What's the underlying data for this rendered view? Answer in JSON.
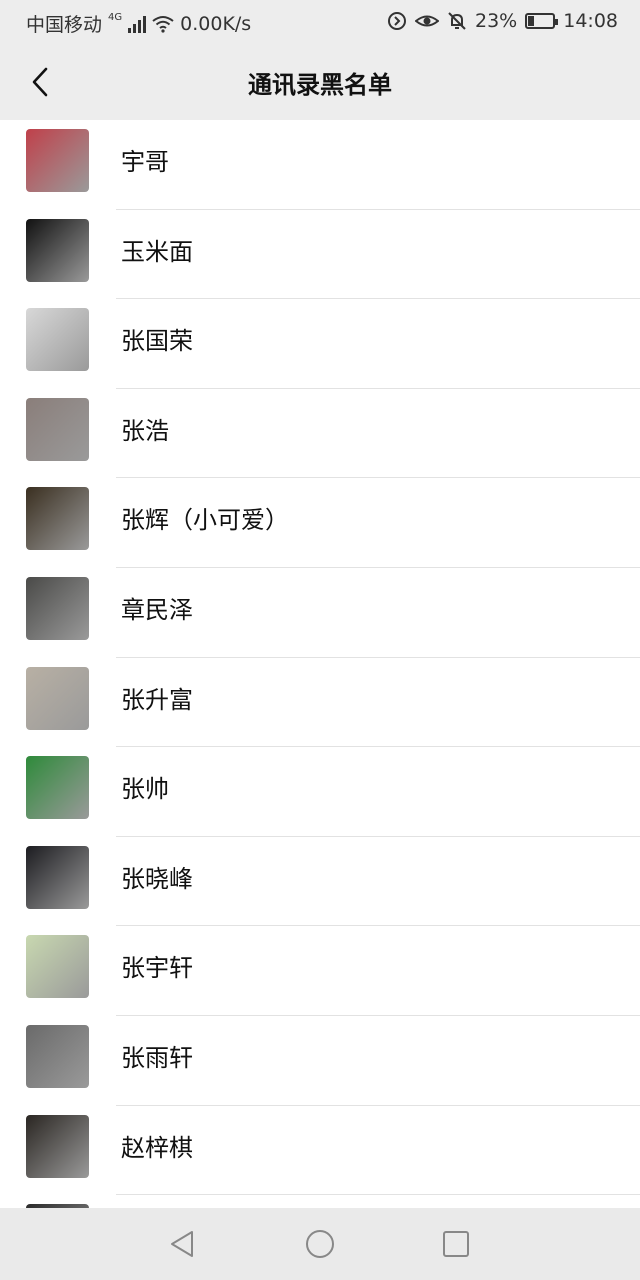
{
  "status": {
    "carrier": "中国移动",
    "network": "4G",
    "speed": "0.00K/s",
    "battery": "23%",
    "battery_level": 0.23,
    "time": "14:08",
    "icons": [
      "signal-icon",
      "wifi-icon",
      "data-saver-icon",
      "eye-comfort-icon",
      "mute-bell-icon",
      "battery-icon"
    ]
  },
  "nav": {
    "title": "通讯录黑名单",
    "back_icon": "chevron-left-icon"
  },
  "contacts": [
    {
      "name": "宇哥",
      "avatar_color": "#c0404a"
    },
    {
      "name": "玉米面",
      "avatar_color": "#111111"
    },
    {
      "name": "张国荣",
      "avatar_color": "#d8d8d8"
    },
    {
      "name": "张浩",
      "avatar_color": "#8a7e7a"
    },
    {
      "name": "张辉（小可爱）",
      "avatar_color": "#3a2f20"
    },
    {
      "name": "章民泽",
      "avatar_color": "#4a4a48"
    },
    {
      "name": "张升富",
      "avatar_color": "#b8b0a4"
    },
    {
      "name": "张帅",
      "avatar_color": "#2e8a3a"
    },
    {
      "name": "张晓峰",
      "avatar_color": "#1c1c20"
    },
    {
      "name": "张宇轩",
      "avatar_color": "#c8d8b0"
    },
    {
      "name": "张雨轩",
      "avatar_color": "#6a6a6a"
    },
    {
      "name": "赵梓棋",
      "avatar_color": "#2a2622"
    },
    {
      "name": "",
      "avatar_color": "#2a2a2a"
    }
  ],
  "bottom_nav": {
    "icons": [
      "back-triangle-icon",
      "home-circle-icon",
      "recents-square-icon"
    ]
  }
}
